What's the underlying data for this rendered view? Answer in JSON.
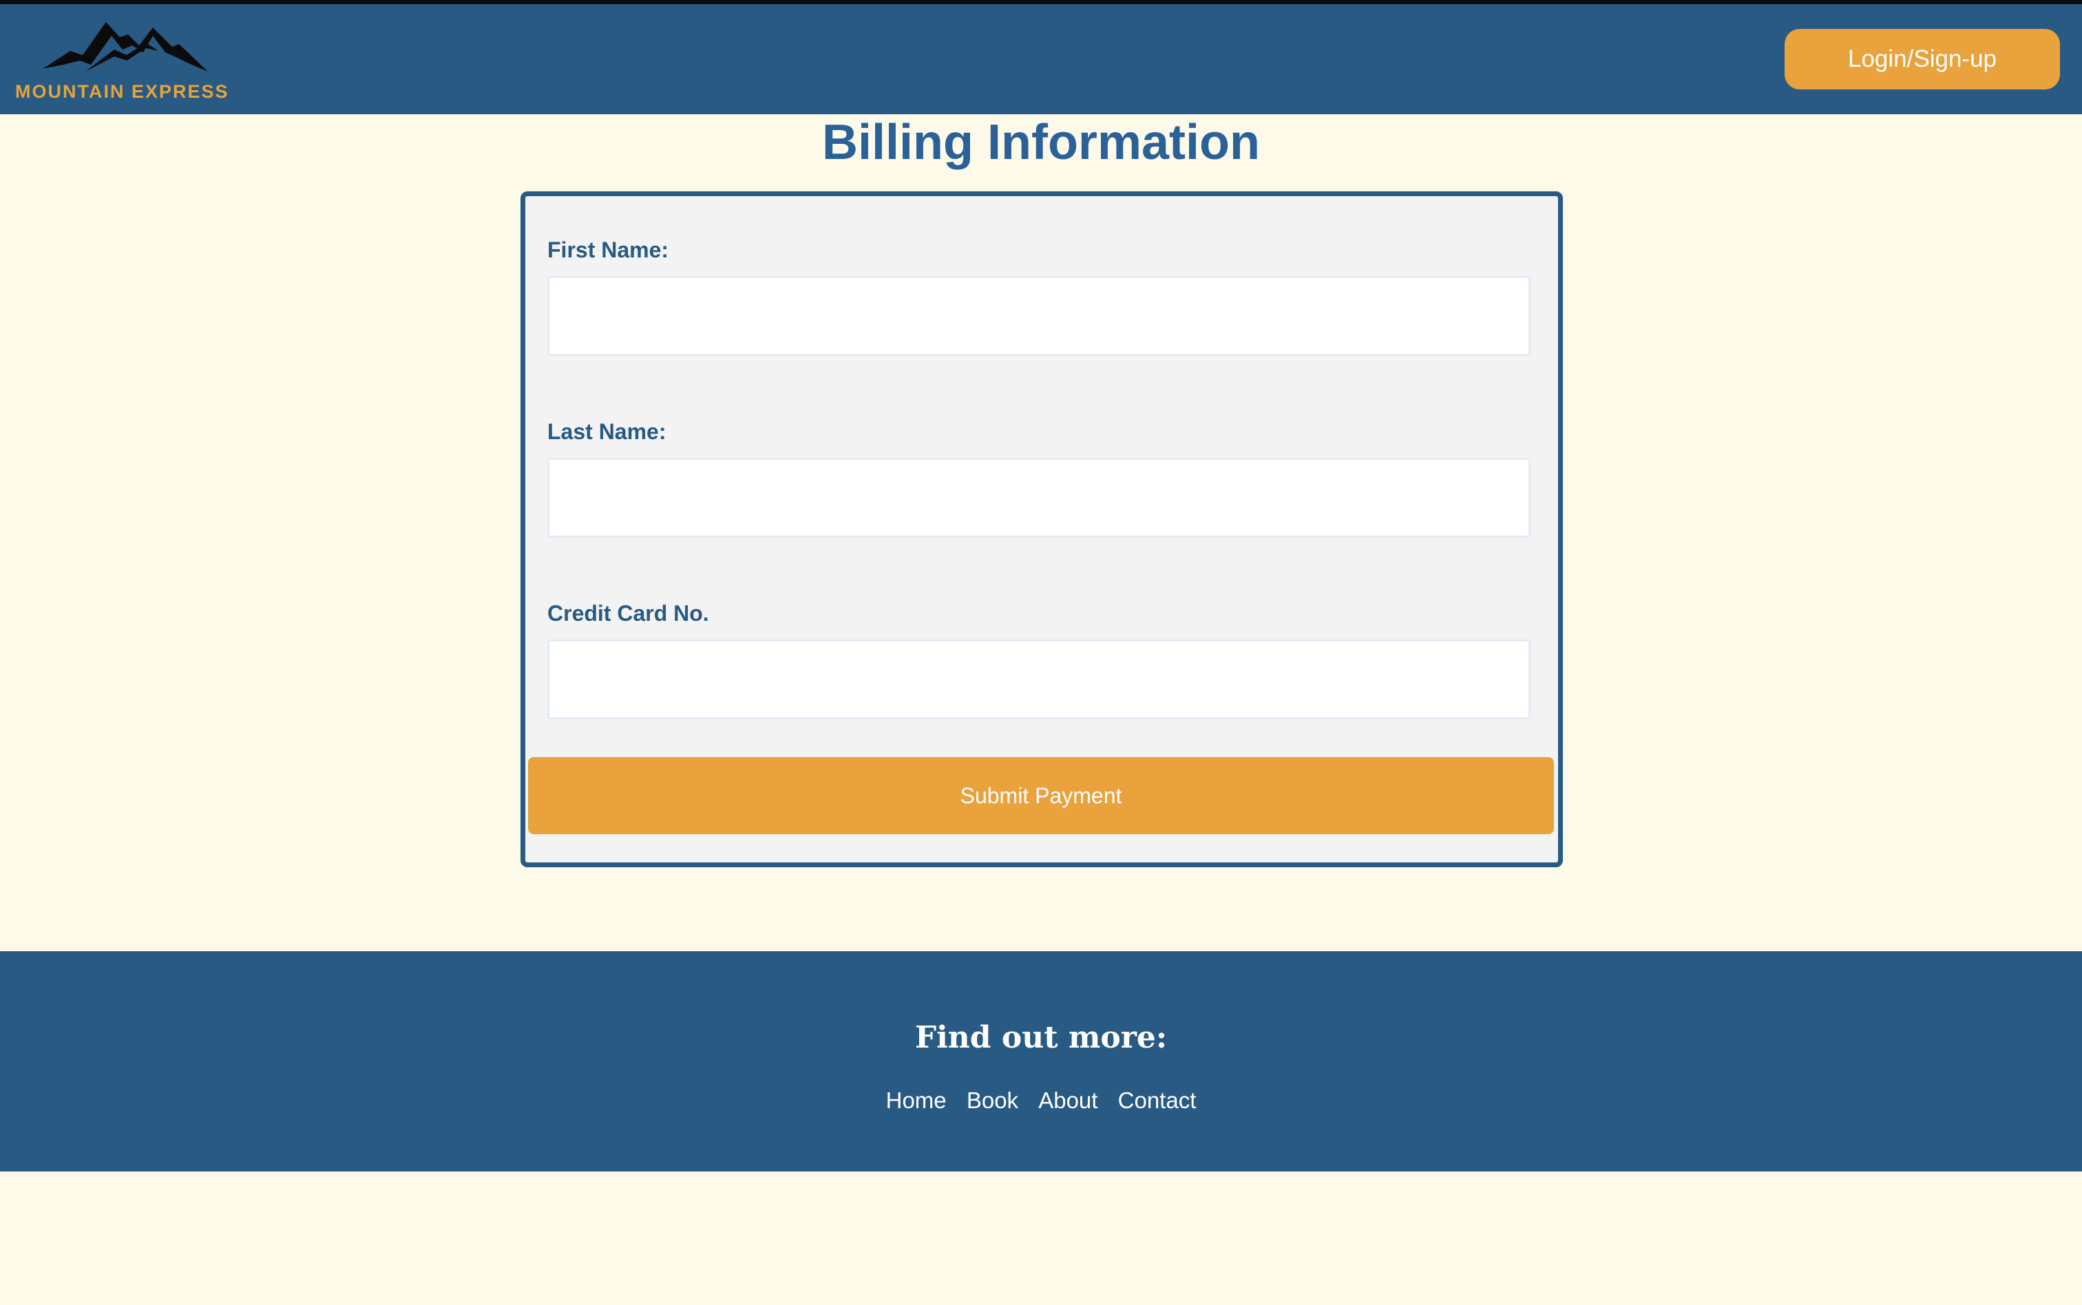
{
  "header": {
    "brand_name": "MOUNTAIN EXPRESS",
    "login_label": "Login/Sign-up"
  },
  "main": {
    "title": "Billing Information",
    "form": {
      "fields": [
        {
          "label": "First Name:",
          "value": "",
          "placeholder": ""
        },
        {
          "label": "Last Name:",
          "value": "",
          "placeholder": ""
        },
        {
          "label": "Credit Card No.",
          "value": "",
          "placeholder": ""
        }
      ],
      "submit_label": "Submit Payment"
    }
  },
  "footer": {
    "heading": "Find out more:",
    "links": [
      {
        "label": "Home"
      },
      {
        "label": "Book"
      },
      {
        "label": "About"
      },
      {
        "label": "Contact"
      }
    ]
  },
  "colors": {
    "primary": "#285a84",
    "accent": "#e9a23c",
    "background": "#fefaea",
    "title": "#2a6198",
    "form_background": "#f3f3f3"
  },
  "icons": {
    "logo": "mountain-logo-icon"
  }
}
